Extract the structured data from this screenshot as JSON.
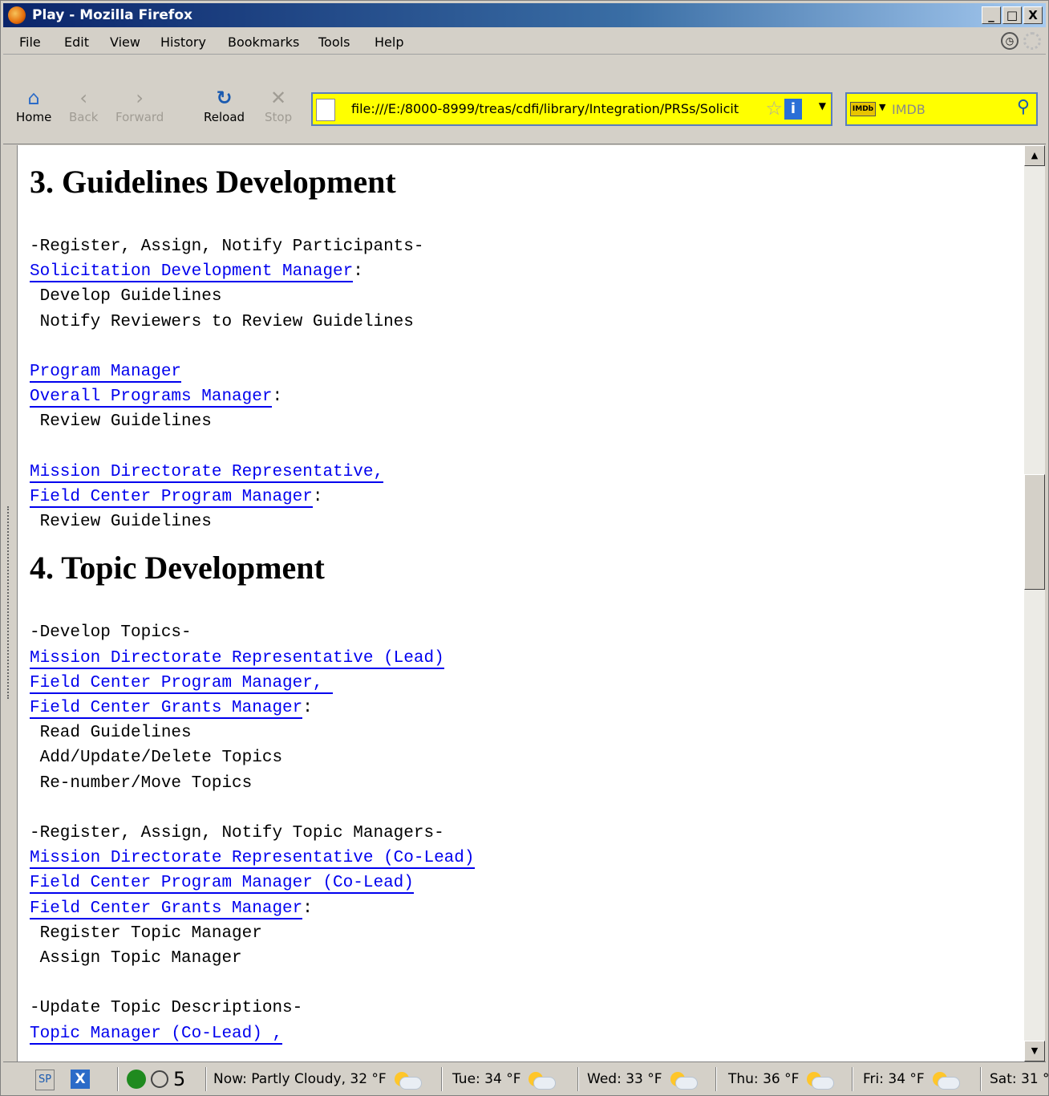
{
  "window": {
    "title": "Play - Mozilla Firefox",
    "buttons": [
      "_",
      "□",
      "X"
    ]
  },
  "menu": [
    "File",
    "Edit",
    "View",
    "History",
    "Bookmarks",
    "Tools",
    "Help"
  ],
  "nav": {
    "home": "Home",
    "back": "Back",
    "forward": "Forward",
    "reload": "Reload",
    "stop": "Stop",
    "url": "file:///E:/8000-8999/treas/cdfi/library/Integration/PRSs/Solicit",
    "search_placeholder": "IMDB",
    "search_engine": "IMDb"
  },
  "sections": [
    {
      "heading": "3. Guidelines Development",
      "lines": [
        {
          "type": "text",
          "text": "-Register, Assign, Notify Participants-"
        },
        {
          "type": "link",
          "text": "Solicitation Development Manager",
          "suffix": ":"
        },
        {
          "type": "text",
          "text": " Develop Guidelines"
        },
        {
          "type": "text",
          "text": " Notify Reviewers to Review Guidelines"
        },
        {
          "type": "blank"
        },
        {
          "type": "link",
          "text": "Program Manager"
        },
        {
          "type": "link",
          "text": "Overall Programs Manager",
          "suffix": ":"
        },
        {
          "type": "text",
          "text": " Review Guidelines"
        },
        {
          "type": "blank"
        },
        {
          "type": "link",
          "text": "Mission Directorate Representative,"
        },
        {
          "type": "link",
          "text": "Field Center Program Manager",
          "suffix": ":"
        },
        {
          "type": "text",
          "text": " Review Guidelines"
        }
      ]
    },
    {
      "heading": "4. Topic Development",
      "lines": [
        {
          "type": "text",
          "text": "-Develop Topics-"
        },
        {
          "type": "link",
          "text": "Mission Directorate Representative (Lead)"
        },
        {
          "type": "link",
          "text": "Field Center Program Manager, "
        },
        {
          "type": "link",
          "text": "Field Center Grants Manager",
          "suffix": ":"
        },
        {
          "type": "text",
          "text": " Read Guidelines"
        },
        {
          "type": "text",
          "text": " Add/Update/Delete Topics"
        },
        {
          "type": "text",
          "text": " Re-number/Move Topics"
        },
        {
          "type": "blank"
        },
        {
          "type": "text",
          "text": "-Register, Assign, Notify Topic Managers-"
        },
        {
          "type": "link",
          "text": "Mission Directorate Representative (Co-Lead)"
        },
        {
          "type": "link",
          "text": "Field Center Program Manager (Co-Lead)"
        },
        {
          "type": "link",
          "text": "Field Center Grants Manager",
          "suffix": ":"
        },
        {
          "type": "text",
          "text": " Register Topic Manager"
        },
        {
          "type": "text",
          "text": " Assign Topic Manager"
        },
        {
          "type": "blank"
        },
        {
          "type": "text",
          "text": "-Update Topic Descriptions-"
        },
        {
          "type": "link",
          "text": "Topic Manager (Co-Lead) ,"
        }
      ]
    }
  ],
  "status": {
    "sp": "SP",
    "count": "5",
    "now": "Now: Partly Cloudy, 32 °F",
    "forecast": [
      "Tue: 34 °F",
      "Wed: 33 °F",
      "Thu: 36 °F",
      "Fri: 34 °F",
      "Sat: 31 °"
    ]
  }
}
